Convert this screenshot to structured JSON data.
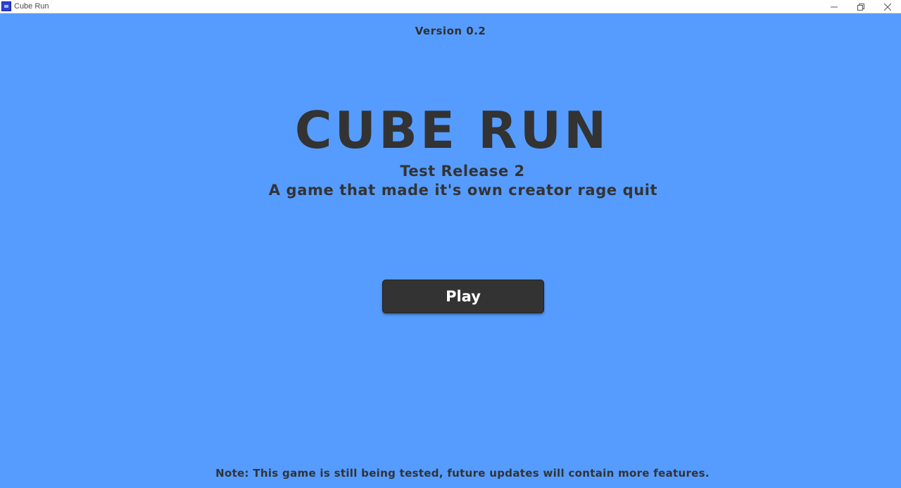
{
  "window": {
    "title": "Cube Run",
    "icon": "cube-run-app-icon",
    "controls": [
      "minimize-icon",
      "restore-icon",
      "close-icon"
    ]
  },
  "game": {
    "version": "Version 0.2",
    "title": "CUBE RUN",
    "subtitle": "Test Release 2",
    "tagline": "A game that made it's own creator rage quit",
    "play_label": "Play",
    "note": "Note: This game is still being tested, future updates will contain more features."
  },
  "colors": {
    "background": "#569cfe",
    "text": "#333333",
    "button": "#333333",
    "button_text": "#ffffff"
  }
}
